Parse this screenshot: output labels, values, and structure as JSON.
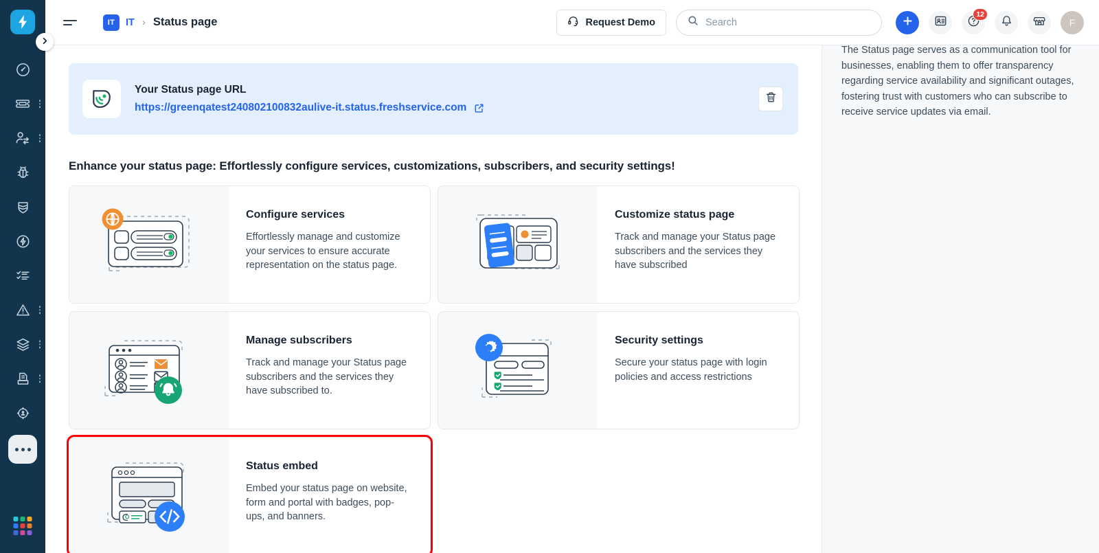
{
  "sidebar": {
    "logo_icon": "freshservice-bolt-logo",
    "expand_icon": "chevron-right-icon",
    "items": [
      {
        "name": "dashboard",
        "icon": "gauge-dashboard-icon",
        "has_overflow": false
      },
      {
        "name": "tickets",
        "icon": "ticket-icon",
        "has_overflow": true
      },
      {
        "name": "requesters",
        "icon": "user-switch-icon",
        "has_overflow": true
      },
      {
        "name": "problems",
        "icon": "bug-icon",
        "has_overflow": false
      },
      {
        "name": "changes",
        "icon": "shield-stack-icon",
        "has_overflow": false
      },
      {
        "name": "automation",
        "icon": "bolt-circle-icon",
        "has_overflow": false
      },
      {
        "name": "tasks",
        "icon": "checklist-icon",
        "has_overflow": false
      },
      {
        "name": "alerts",
        "icon": "alert-triangle-icon",
        "has_overflow": true
      },
      {
        "name": "assets",
        "icon": "layers-icon",
        "has_overflow": true
      },
      {
        "name": "releases",
        "icon": "document-tray-icon",
        "has_overflow": true
      },
      {
        "name": "projects",
        "icon": "user-target-icon",
        "has_overflow": false
      }
    ],
    "more_icon": "ellipsis-icon",
    "switcher_icon": "app-switcher-grid-icon",
    "switcher_colors": [
      "#2bc5d9",
      "#21b573",
      "#f5a623",
      "#2d7ff9",
      "#e8403a",
      "#f07c2b",
      "#3f6ad8",
      "#d6489a",
      "#8a5fd6"
    ]
  },
  "topbar": {
    "menu_icon": "hamburger-menu-icon",
    "workspace_badge": "IT",
    "workspace_label": "IT",
    "breadcrumb_separator": "›",
    "page_title": "Status page",
    "request_demo_label": "Request Demo",
    "request_demo_icon": "headset-icon",
    "search_icon": "search-icon",
    "search_value": "",
    "search_placeholder": "Search",
    "add_icon": "plus-icon",
    "contacts_icon": "contact-card-icon",
    "help_icon": "question-circle-icon",
    "help_badge": "12",
    "notifications_icon": "bell-icon",
    "marketplace_icon": "storefront-icon",
    "avatar_initial": "F"
  },
  "url_banner": {
    "icon": "status-page-shield-icon",
    "title": "Your Status page URL",
    "url": "https://greenqatest240802100832aulive-it.status.freshservice.com",
    "external_icon": "external-link-icon",
    "delete_icon": "trash-icon"
  },
  "main": {
    "enhance_title": "Enhance your status page: Effortlessly configure services, customizations, subscribers, and security settings!",
    "cards": [
      {
        "id": "configure-services",
        "title": "Configure services",
        "description": "Effortlessly manage and customize your services to ensure accurate representation on the status page.",
        "illustration": "globe-services-list-illustration",
        "accent": "#ef8b2c",
        "highlighted": false
      },
      {
        "id": "customize-status-page",
        "title": "Customize status page",
        "description": "Track and manage your Status page subscribers and the services they have subscribed",
        "illustration": "layout-customize-illustration",
        "accent": "#2d7ff9",
        "highlighted": false
      },
      {
        "id": "manage-subscribers",
        "title": "Manage subscribers",
        "description": "Track and manage your Status page subscribers and the services they have subscribed to.",
        "illustration": "subscribers-bell-illustration",
        "accent": "#17a673",
        "highlighted": false
      },
      {
        "id": "security-settings",
        "title": "Security settings",
        "description": "Secure your status page with login policies and access restrictions",
        "illustration": "gear-security-illustration",
        "accent": "#2d7ff9",
        "highlighted": false
      },
      {
        "id": "status-embed",
        "title": "Status embed",
        "description": "Embed your status page on website, form and portal with badges, pop-ups, and banners.",
        "illustration": "code-embed-illustration",
        "accent": "#2d7ff9",
        "highlighted": true
      }
    ]
  },
  "aside": {
    "description": "The Status page serves as a communication tool for businesses, enabling them to offer transparency regarding service availability and significant outages, fostering trust with customers who can subscribe to receive service updates via email."
  },
  "colors": {
    "rail_bg": "#12344d",
    "brand_blue": "#2563eb",
    "banner_bg": "#e3effc",
    "highlight_red": "#fb0007",
    "card_illo_bg": "#f7f8f9",
    "aside_bg": "#f7f8f9"
  }
}
